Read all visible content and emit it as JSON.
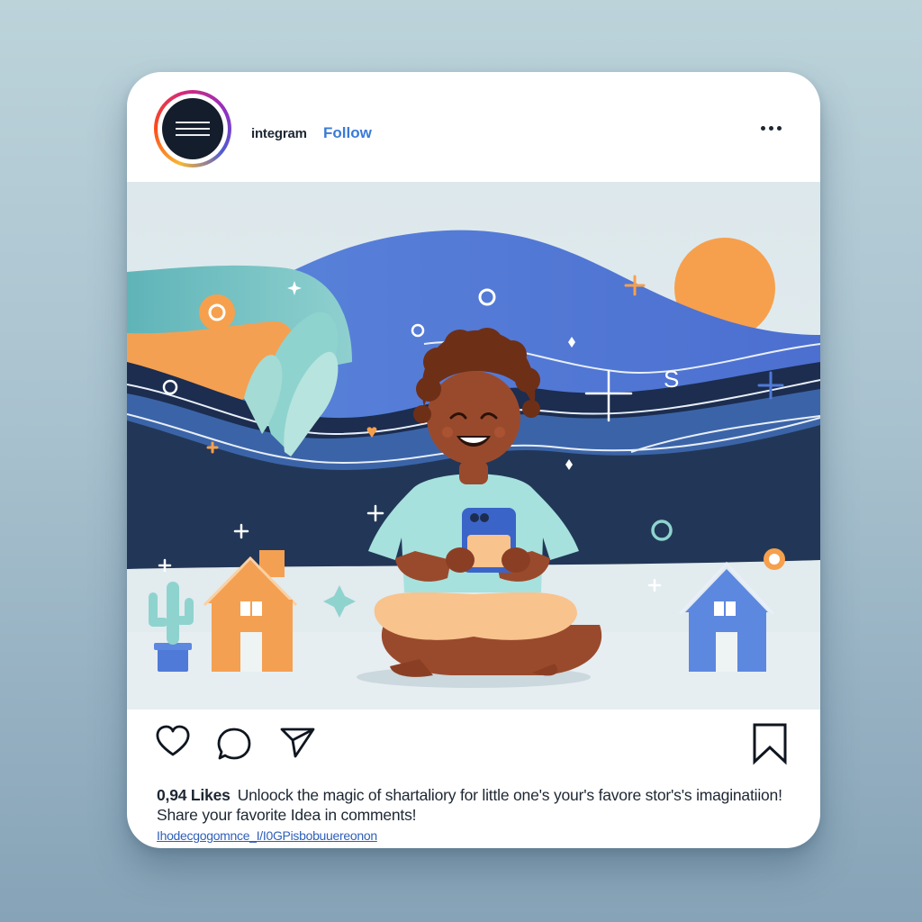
{
  "header": {
    "username": "integram",
    "follow_label": "Follow",
    "more_icon": "more-horizontal-icon"
  },
  "post": {
    "image_alt_icons": [
      "sun",
      "house",
      "cactus",
      "smartphone"
    ]
  },
  "actions": {
    "like_icon": "heart-icon",
    "comment_icon": "comment-icon",
    "share_icon": "send-icon",
    "save_icon": "bookmark-icon"
  },
  "caption": {
    "likes": "0,94 Likes",
    "text": "Unloock the magic of  shartaliory for little one's your's favore stor's's imaginatiion! Share your favorite Idea in comments!",
    "link": "Ihodecgogomnce_I/I0GPisbobuuereonon"
  },
  "bottom_nav": {
    "home_icon": "home-dot-icon",
    "search_icon": "search-icon",
    "pager_icon": "pager-dots-icon",
    "saved_icon": "bookmark-icon"
  },
  "colors": {
    "accent": "#3a7ad8",
    "sun": "#f6a04d",
    "sky": "#e3edf0",
    "navy": "#1b2b47",
    "royal_blue": "#5076d6"
  }
}
